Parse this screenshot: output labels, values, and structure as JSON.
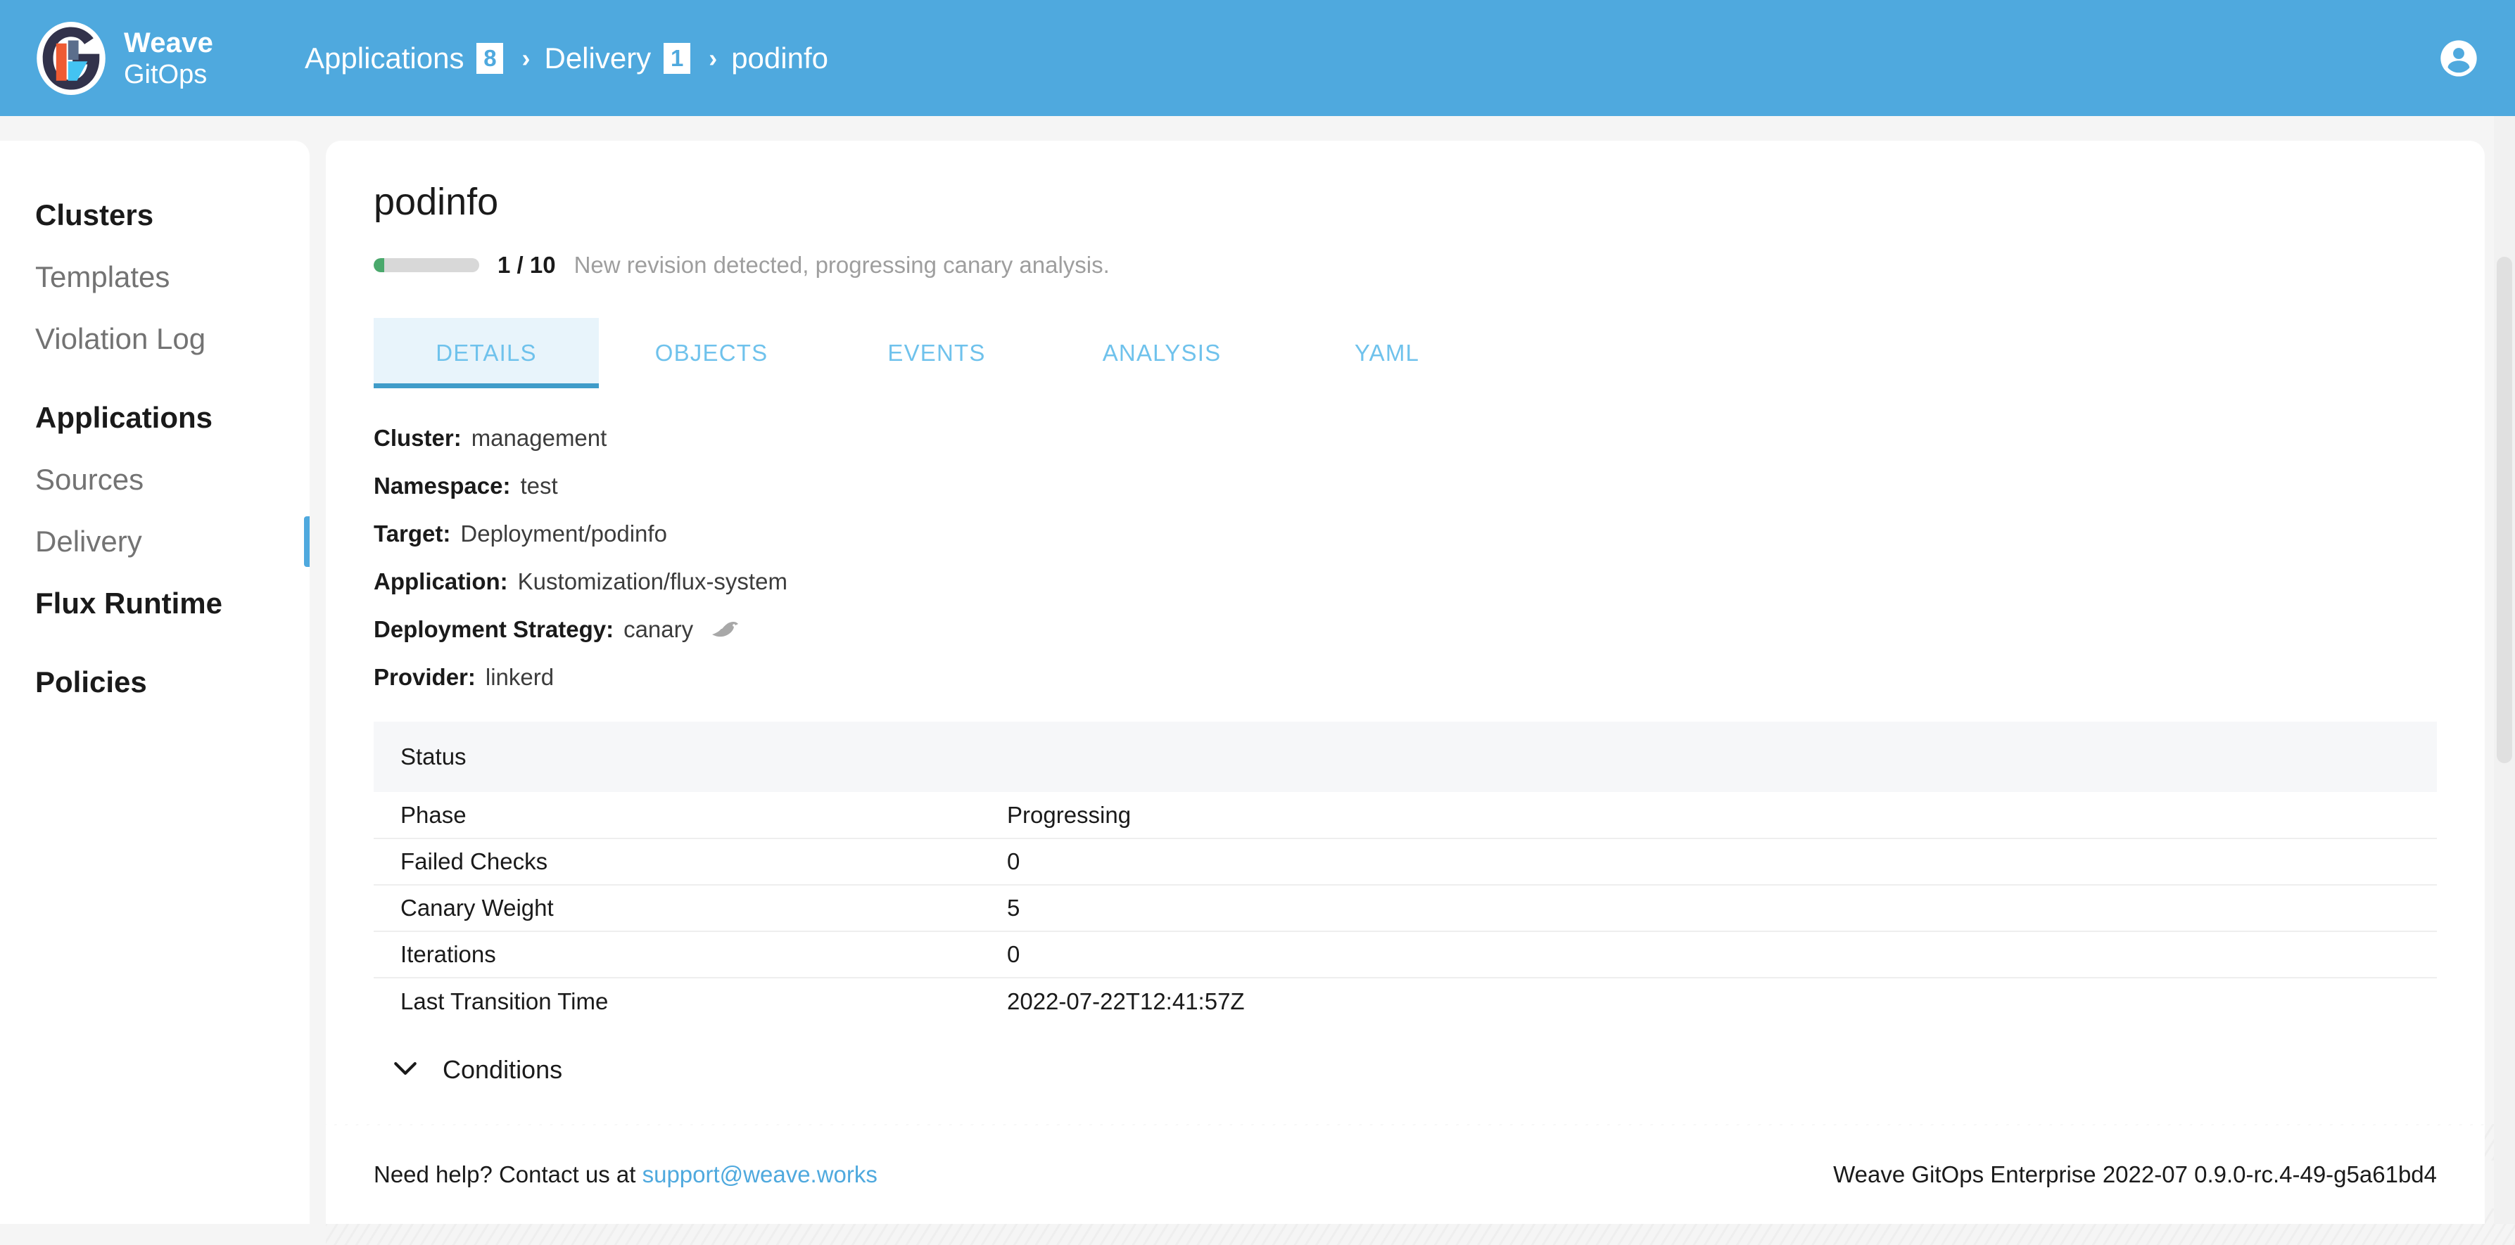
{
  "brand": {
    "name_line1": "Weave",
    "name_line2": "GitOps",
    "logo_icon": "weave-gitops-logo"
  },
  "header": {
    "background_color": "#4fa9de",
    "account_icon": "account-circle-icon",
    "breadcrumb": [
      {
        "label": "Applications",
        "badge": "8"
      },
      {
        "label": "Delivery",
        "badge": "1"
      },
      {
        "label": "podinfo",
        "badge": ""
      }
    ],
    "separator": "›"
  },
  "sidebar": {
    "items": [
      {
        "label": "Clusters",
        "level": "primary",
        "active": false
      },
      {
        "label": "Templates",
        "level": "sub",
        "active": false
      },
      {
        "label": "Violation Log",
        "level": "sub",
        "active": false
      },
      {
        "label": "Applications",
        "level": "primary",
        "active": false
      },
      {
        "label": "Sources",
        "level": "sub",
        "active": false
      },
      {
        "label": "Delivery",
        "level": "sub",
        "active": true
      },
      {
        "label": "Flux Runtime",
        "level": "primary",
        "active": false
      },
      {
        "label": "Policies",
        "level": "primary",
        "active": false
      }
    ],
    "active_indicator_color": "#4fa9de"
  },
  "main": {
    "title": "podinfo",
    "progress": {
      "current": 1,
      "total": 10,
      "count_label": "1 / 10",
      "percent": 10,
      "message": "New revision detected, progressing canary analysis.",
      "fill_color": "#4aa96c",
      "track_color": "#d8d8d8"
    },
    "tabs": [
      {
        "label": "DETAILS",
        "active": true
      },
      {
        "label": "OBJECTS",
        "active": false
      },
      {
        "label": "EVENTS",
        "active": false
      },
      {
        "label": "ANALYSIS",
        "active": false
      },
      {
        "label": "YAML",
        "active": false
      }
    ],
    "details": [
      {
        "key": "Cluster:",
        "value": "management",
        "icon": ""
      },
      {
        "key": "Namespace:",
        "value": "test",
        "icon": ""
      },
      {
        "key": "Target:",
        "value": "Deployment/podinfo",
        "icon": ""
      },
      {
        "key": "Application:",
        "value": "Kustomization/flux-system",
        "icon": ""
      },
      {
        "key": "Deployment Strategy:",
        "value": "canary",
        "icon": "flagger-bird-icon"
      },
      {
        "key": "Provider:",
        "value": "linkerd",
        "icon": ""
      }
    ],
    "status": {
      "panel_title": "Status",
      "rows": [
        {
          "key": "Phase",
          "value": "Progressing"
        },
        {
          "key": "Failed Checks",
          "value": "0"
        },
        {
          "key": "Canary Weight",
          "value": "5"
        },
        {
          "key": "Iterations",
          "value": "0"
        },
        {
          "key": "Last Transition Time",
          "value": "2022-07-22T12:41:57Z"
        }
      ]
    },
    "conditions": {
      "label": "Conditions",
      "icon": "chevron-down-icon",
      "expanded": false
    }
  },
  "footer": {
    "help_text": "Need help? Contact us at ",
    "support_email": "support@weave.works",
    "version": "Weave GitOps Enterprise 2022-07 0.9.0-rc.4-49-g5a61bd4"
  }
}
